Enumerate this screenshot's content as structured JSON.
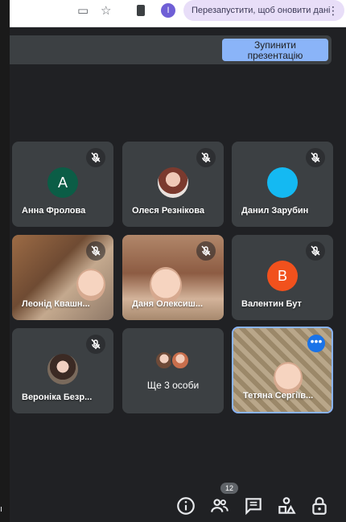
{
  "chrome": {
    "update_text": "Перезапустити, щоб оновити дані",
    "kebab": "⋮",
    "profile_letter": "I"
  },
  "presentation": {
    "stop_label_line1": "Зупинити",
    "stop_label_line2": "презентацію"
  },
  "participants": [
    {
      "name": "Анна Фролова",
      "avatar_letter": "A",
      "avatar_color": "#0b5d46"
    },
    {
      "name": "Олеся Резнікова"
    },
    {
      "name": "Данил Зарубин"
    },
    {
      "name": "Леонід Квашн..."
    },
    {
      "name": "Даня Олексиш..."
    },
    {
      "name": "Валентин Бут",
      "avatar_letter": "B",
      "avatar_color": "#f1511d"
    },
    {
      "name": "Вероніка Безр..."
    },
    {
      "name": "Ще 3 особи"
    },
    {
      "name": "Тетяна Сергіїв..."
    }
  ],
  "toolbar": {
    "people_count": "12"
  },
  "left_strip_char": "ı"
}
